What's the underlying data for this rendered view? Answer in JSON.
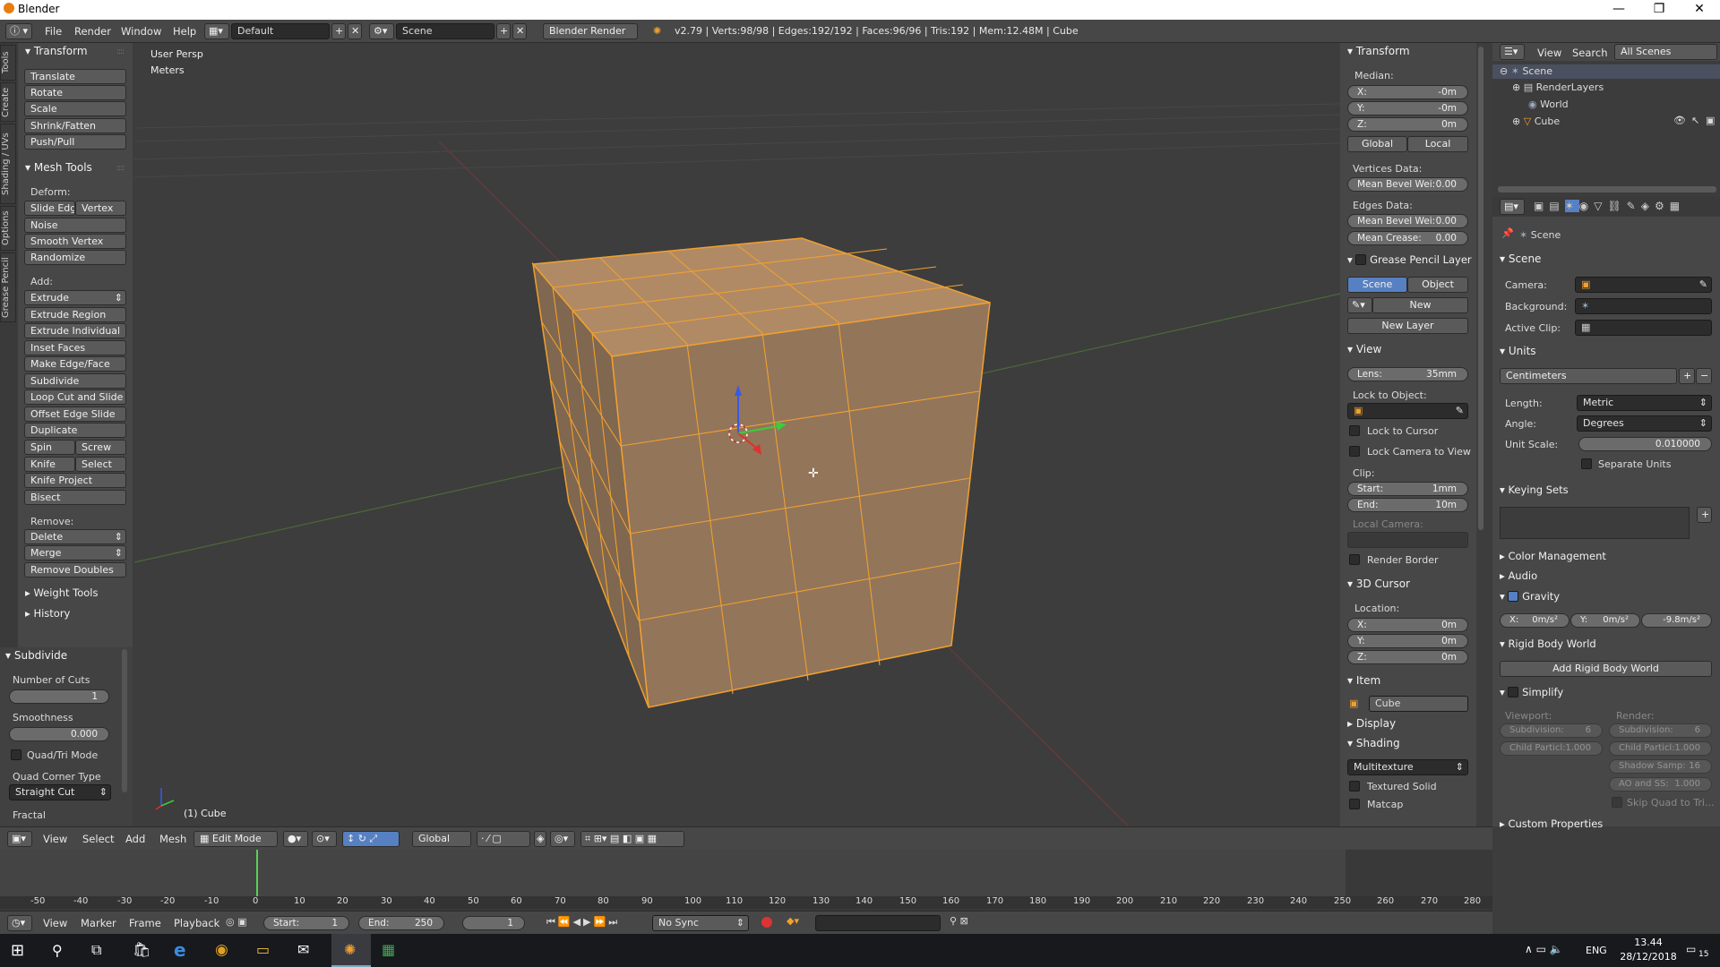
{
  "window": {
    "title": "Blender"
  },
  "menubar": {
    "items": [
      "File",
      "Render",
      "Window",
      "Help"
    ],
    "layout": "Default",
    "scene": "Scene",
    "engine": "Blender Render",
    "stats": "v2.79 | Verts:98/98 | Edges:192/192 | Faces:96/96 | Tris:192 | Mem:12.48M | Cube"
  },
  "toolshelf": {
    "tabs": [
      "Tools",
      "Create",
      "Shading / UVs",
      "Options",
      "Grease Pencil"
    ],
    "transform_header": "Transform",
    "transform": [
      "Translate",
      "Rotate",
      "Scale",
      "Shrink/Fatten",
      "Push/Pull"
    ],
    "meshtools_header": "Mesh Tools",
    "deform_label": "Deform:",
    "slide_edge": "Slide Edg",
    "vertex": "Vertex",
    "deform": [
      "Noise",
      "Smooth Vertex",
      "Randomize"
    ],
    "add_label": "Add:",
    "extrude": "Extrude",
    "add": [
      "Extrude Region",
      "Extrude Individual",
      "Inset Faces",
      "Make Edge/Face",
      "Subdivide",
      "Loop Cut and Slide",
      "Offset Edge Slide",
      "Duplicate"
    ],
    "spin": "Spin",
    "screw": "Screw",
    "knife": "Knife",
    "select": "Select",
    "knife_project": "Knife Project",
    "bisect": "Bisect",
    "remove_label": "Remove:",
    "delete": "Delete",
    "merge": "Merge",
    "remove_doubles": "Remove Doubles",
    "weight_tools": "Weight Tools",
    "history": "History"
  },
  "operator": {
    "header": "Subdivide",
    "cuts_label": "Number of Cuts",
    "cuts": "1",
    "smooth_label": "Smoothness",
    "smooth": "0.000",
    "quadtri": "Quad/Tri Mode",
    "corner_label": "Quad Corner Type",
    "corner": "Straight Cut",
    "fractal": "Fractal"
  },
  "viewport": {
    "view_name": "User Persp",
    "units": "Meters",
    "object": "(1) Cube"
  },
  "props_n": {
    "transform_header": "Transform",
    "median": "Median:",
    "x_label": "X:",
    "x": "-0m",
    "y_label": "Y:",
    "y": "-0m",
    "z_label": "Z:",
    "z": "0m",
    "global": "Global",
    "local": "Local",
    "vdata": "Vertices Data:",
    "mbw_label": "Mean Bevel Wei:",
    "mbw": "0.00",
    "edata": "Edges Data:",
    "mbw2": "0.00",
    "crease_label": "Mean Crease:",
    "crease": "0.00",
    "gp_header": "Grease Pencil Layer",
    "scene_tab": "Scene",
    "object_tab": "Object",
    "new": "New",
    "new_layer": "New Layer",
    "view_header": "View",
    "lens_label": "Lens:",
    "lens": "35mm",
    "lock_obj": "Lock to Object:",
    "lock_cursor": "Lock to Cursor",
    "lock_camera": "Lock Camera to View",
    "clip": "Clip:",
    "start_label": "Start:",
    "start": "1mm",
    "end_label": "End:",
    "end": "10m",
    "local_camera": "Local Camera:",
    "render_border": "Render Border",
    "cursor_header": "3D Cursor",
    "location": "Location:",
    "cx": "0m",
    "cy": "0m",
    "cz": "0m",
    "item_header": "Item",
    "item_name": "Cube",
    "display_header": "Display",
    "shading_header": "Shading",
    "shading_mode": "Multitexture",
    "textured_solid": "Textured Solid",
    "matcap": "Matcap"
  },
  "outliner": {
    "view": "View",
    "search": "Search",
    "filter": "All Scenes",
    "items": [
      "Scene",
      "RenderLayers",
      "World",
      "Cube"
    ]
  },
  "properties": {
    "breadcrumb": "Scene",
    "scene_header": "Scene",
    "camera": "Camera:",
    "background": "Background:",
    "active_clip": "Active Clip:",
    "units_header": "Units",
    "unit_preset": "Centimeters",
    "length_label": "Length:",
    "length": "Metric",
    "angle_label": "Angle:",
    "angle": "Degrees",
    "scale_label": "Unit Scale:",
    "scale": "0.010000",
    "separate": "Separate Units",
    "keying_header": "Keying Sets",
    "color_mgmt": "Color Management",
    "audio": "Audio",
    "gravity": "Gravity",
    "gx": "0m/s²",
    "gy": "0m/s²",
    "gz": "-9.8m/s²",
    "rigid": "Rigid Body World",
    "add_rigid": "Add Rigid Body World",
    "simplify": "Simplify",
    "viewport_lbl": "Viewport:",
    "render_lbl": "Render:",
    "subdiv_label": "Subdivision:",
    "subdiv": "6",
    "subdiv_r": "6",
    "child_label": "Child Particl:",
    "child": "1.000",
    "child_r": "1.000",
    "shadow_label": "Shadow Samp:",
    "shadow": "16",
    "ao_label": "AO and SS:",
    "ao": "1.000",
    "skip": "Skip Quad to Tri...",
    "custom": "Custom Properties"
  },
  "view3d_header": {
    "items": [
      "View",
      "Select",
      "Add",
      "Mesh"
    ],
    "mode": "Edit Mode",
    "orientation": "Global"
  },
  "timeline": {
    "ticks": [
      "-50",
      "-40",
      "-30",
      "-20",
      "-10",
      "0",
      "10",
      "20",
      "30",
      "40",
      "50",
      "60",
      "70",
      "80",
      "90",
      "100",
      "110",
      "120",
      "130",
      "140",
      "150",
      "160",
      "170",
      "180",
      "190",
      "200",
      "210",
      "220",
      "230",
      "240",
      "250",
      "260",
      "270",
      "280"
    ],
    "menu": [
      "View",
      "Marker",
      "Frame",
      "Playback"
    ],
    "start_label": "Start:",
    "start": "1",
    "end_label": "End:",
    "end": "250",
    "current": "1",
    "sync": "No Sync"
  },
  "taskbar": {
    "lang": "ENG",
    "time": "13.44",
    "date": "28/12/2018",
    "notif": "15"
  },
  "colors": {
    "accent": "#5680c2",
    "orange": "#f0a030",
    "bg": "#3d3d3d",
    "panel": "#474747"
  }
}
